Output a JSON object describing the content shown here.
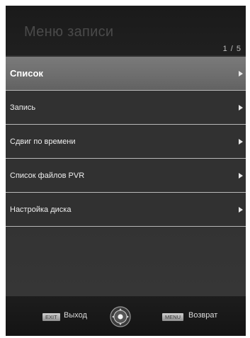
{
  "header": {
    "title": "Меню записи",
    "page_indicator": "1 / 5"
  },
  "menu": {
    "items": [
      {
        "label": "Список",
        "selected": true
      },
      {
        "label": "Запись",
        "selected": false
      },
      {
        "label": "Сдвиг по времени",
        "selected": false
      },
      {
        "label": "Список файлов PVR",
        "selected": false
      },
      {
        "label": "Настройка диска",
        "selected": false
      }
    ]
  },
  "footer": {
    "exit_key": "EXIT",
    "exit_label": "Выход",
    "menu_key": "MENU",
    "menu_label": "Возврат",
    "navigation_icon": "dpad-icon"
  },
  "colors": {
    "background": "#2f2f2f",
    "selected_row": "#707070",
    "separator": "#b8b8b8",
    "text": "#eeeeee"
  }
}
